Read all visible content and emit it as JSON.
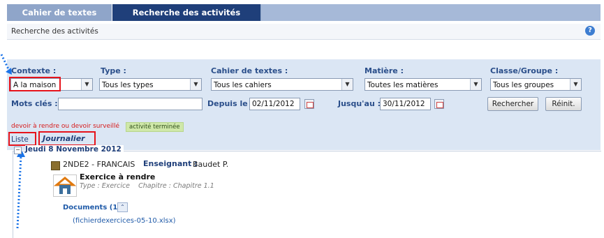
{
  "tabs": [
    {
      "label": "Cahier de textes",
      "active": false
    },
    {
      "label": "Recherche des activités",
      "active": true
    }
  ],
  "page_title": "Recherche des activités",
  "help_glyph": "?",
  "search": {
    "contexte": {
      "label": "Contexte :",
      "value": "A la maison"
    },
    "type": {
      "label": "Type :",
      "value": "Tous les types"
    },
    "cahier": {
      "label": "Cahier de textes :",
      "value": "Tous les cahiers"
    },
    "matiere": {
      "label": "Matière :",
      "value": "Toutes les matières"
    },
    "classe": {
      "label": "Classe/Groupe :",
      "value": "Tous les groupes"
    },
    "mots_cles": {
      "label": "Mots clés :",
      "value": ""
    },
    "depuis": {
      "label": "Depuis le :",
      "value": "02/11/2012"
    },
    "jusqua": {
      "label": "Jusqu'au :",
      "value": "30/11/2012"
    },
    "btn_rechercher": "Rechercher",
    "btn_reinit": "Réinit."
  },
  "legend": {
    "due": "devoir à rendre ou devoir surveillé",
    "done": "activité terminée"
  },
  "views": {
    "liste": "Liste",
    "journalier": "Journalier"
  },
  "day": {
    "toggle": "−",
    "title": "Jeudi 8 Novembre 2012",
    "course": "2NDE2 - FRANCAIS",
    "teacher_label": "Enseignant :",
    "teacher": "Baudet P.",
    "activity_title": "Exercice à rendre",
    "activity_type": "Type : Exercice",
    "activity_chapter": "Chapitre : Chapitre 1.1",
    "documents_label": "Documents (1)",
    "doc_toggle": "⌃",
    "file": "(fichierdexercices-05-10.xlsx)"
  },
  "colors": {
    "annotation_red": "#e6131b",
    "tab_active": "#1f3f7a",
    "arrow_blue": "#1a73e8"
  }
}
